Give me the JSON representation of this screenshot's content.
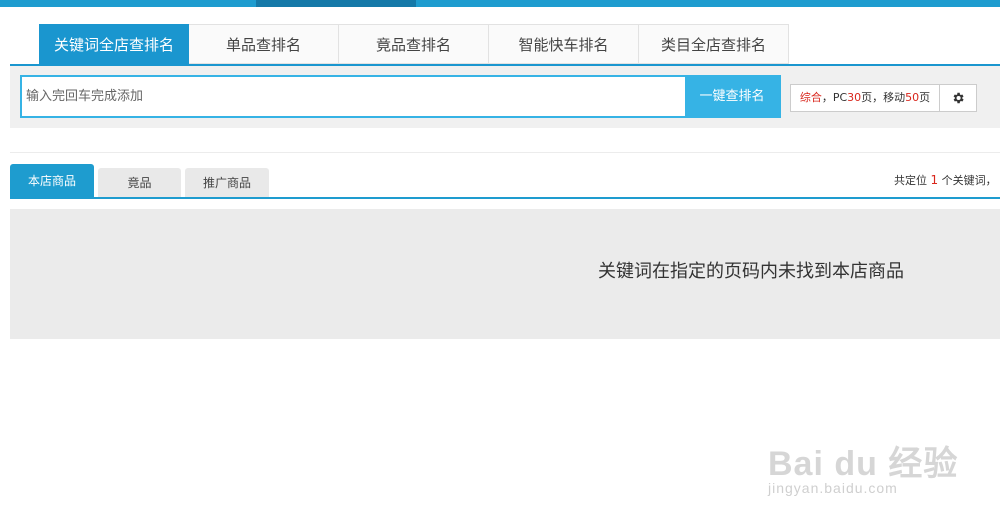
{
  "main_tabs": [
    "关键词全店查排名",
    "单品查排名",
    "竟品查排名",
    "智能快车排名",
    "类目全店查排名"
  ],
  "search": {
    "placeholder": "输入完回车完成添加",
    "button_label": "一键查排名"
  },
  "settings": {
    "mode_label": "综合",
    "sep1": "，PC",
    "pc_pages": "30",
    "sep2": "页，移动",
    "mobile_pages": "50",
    "suffix": "页"
  },
  "sub_tabs": [
    "本店商品",
    "竟品",
    "推广商品"
  ],
  "count": {
    "prefix": "共定位",
    "number": "1",
    "suffix": "个关键词，"
  },
  "result_message": "关键词在指定的页码内未找到本店商品",
  "watermark": {
    "logo": "Bai du 经验",
    "url": "jingyan.baidu.com"
  },
  "colors": {
    "accent": "#1a96cf",
    "button": "#36b3e5",
    "highlight": "#d9261c"
  }
}
